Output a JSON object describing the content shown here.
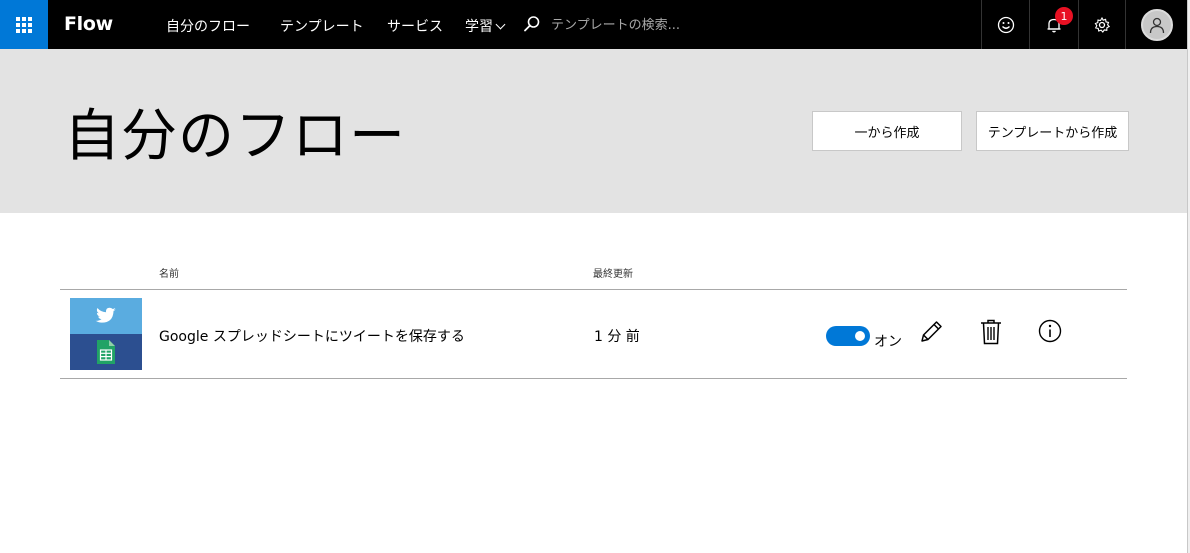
{
  "topbar": {
    "brand": "Flow",
    "nav": [
      "自分のフロー",
      "テンプレート",
      "サービス",
      "学習"
    ],
    "search_placeholder": "テンプレートの検索...",
    "notification_count": "1"
  },
  "header": {
    "title": "自分のフロー",
    "create_blank_label": "一から作成",
    "create_template_label": "テンプレートから作成"
  },
  "table": {
    "col_name": "名前",
    "col_modified": "最終更新",
    "rows": [
      {
        "name": "Google スプレッドシートにツイートを保存する",
        "modified": "1 分 前",
        "status": "オン"
      }
    ]
  },
  "colors": {
    "accent": "#0078d7",
    "topbar": "#000000",
    "header_band": "#e3e3e3",
    "twitter": "#5aace0",
    "sheets_band": "#2c4f90",
    "sheets_icon": "#21a366",
    "badge": "#e81123"
  },
  "icons": [
    "waffle-icon",
    "search-icon",
    "smiley-icon",
    "bell-icon",
    "gear-icon",
    "person-icon",
    "twitter-icon",
    "sheets-icon",
    "pencil-icon",
    "trash-icon",
    "info-icon"
  ]
}
